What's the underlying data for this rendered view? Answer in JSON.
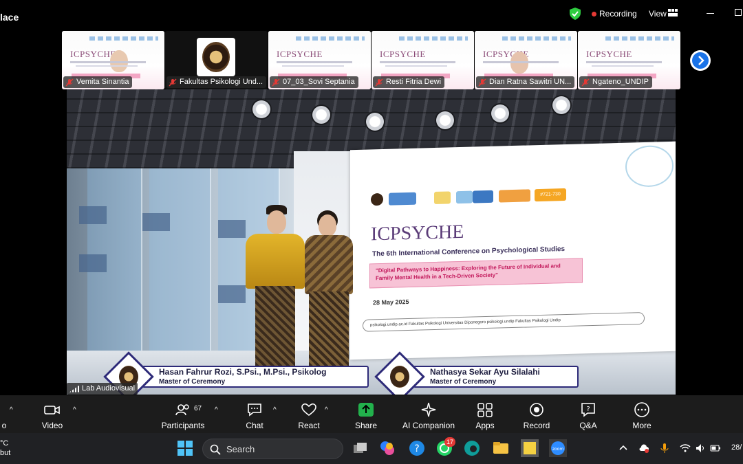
{
  "window": {
    "title": "lace"
  },
  "topbar": {
    "recording_label": "Recording",
    "view_label": "View",
    "security_icon": "shield-check-icon",
    "colors": {
      "shield": "#2ecc40",
      "record_dot": "#e53935"
    }
  },
  "participants": [
    {
      "name": "Vemita Sinantia",
      "muted": true
    },
    {
      "name": "Fakultas Psikologi Und...",
      "muted": true
    },
    {
      "name": "07_03_Sovi Septania",
      "muted": true
    },
    {
      "name": "Resti Fitria Dewi",
      "muted": true
    },
    {
      "name": "Dian Ratna Sawitri UN...",
      "muted": true
    },
    {
      "name": "Ngateno_UNDIP",
      "muted": true
    }
  ],
  "thumb_logo_text": "ICPSYCHE",
  "stage": {
    "screen": {
      "logo_text": "ICPSYCHE",
      "conference_title": "The 6th International Conference on Psychological Studies",
      "theme": "\"Digital Pathways to Happiness: Exploring the Future of Individual and Family Mental Health in a Tech-Driven Society\"",
      "date": "28 May 2025",
      "footer": "psikologi.undip.ac.id     Fakultas Psikologi Universitas Diponegoro     psikologi.undip     Fakultas Psikologi Undip",
      "badge_text": "#721-730"
    },
    "captions": [
      {
        "name": "Hasan Fahrur Rozi, S.Psi., M.Psi., Psikolog",
        "role": "Master of Ceremony"
      },
      {
        "name": "Nathasya Sekar Ayu Silalahi",
        "role": "Master of Ceremony"
      }
    ],
    "source_label": "Lab Audiovisual"
  },
  "toolbar": {
    "items": [
      {
        "label": "o",
        "icon": "mic-icon"
      },
      {
        "label": "Video",
        "icon": "video-camera-icon"
      },
      {
        "label": "Participants",
        "icon": "participants-icon",
        "count": "67"
      },
      {
        "label": "Chat",
        "icon": "chat-icon"
      },
      {
        "label": "React",
        "icon": "heart-icon"
      },
      {
        "label": "Share",
        "icon": "share-screen-icon"
      },
      {
        "label": "AI Companion",
        "icon": "sparkle-icon"
      },
      {
        "label": "Apps",
        "icon": "apps-icon"
      },
      {
        "label": "Record",
        "icon": "record-icon"
      },
      {
        "label": "Q&A",
        "icon": "qa-icon"
      },
      {
        "label": "More",
        "icon": "more-icon"
      }
    ],
    "colors": {
      "share": "#22b14c"
    }
  },
  "taskbar": {
    "weather_line1": "°C",
    "weather_line2": "but",
    "search_placeholder": "Search",
    "whatsapp_badge": "17",
    "clock": "28/"
  }
}
